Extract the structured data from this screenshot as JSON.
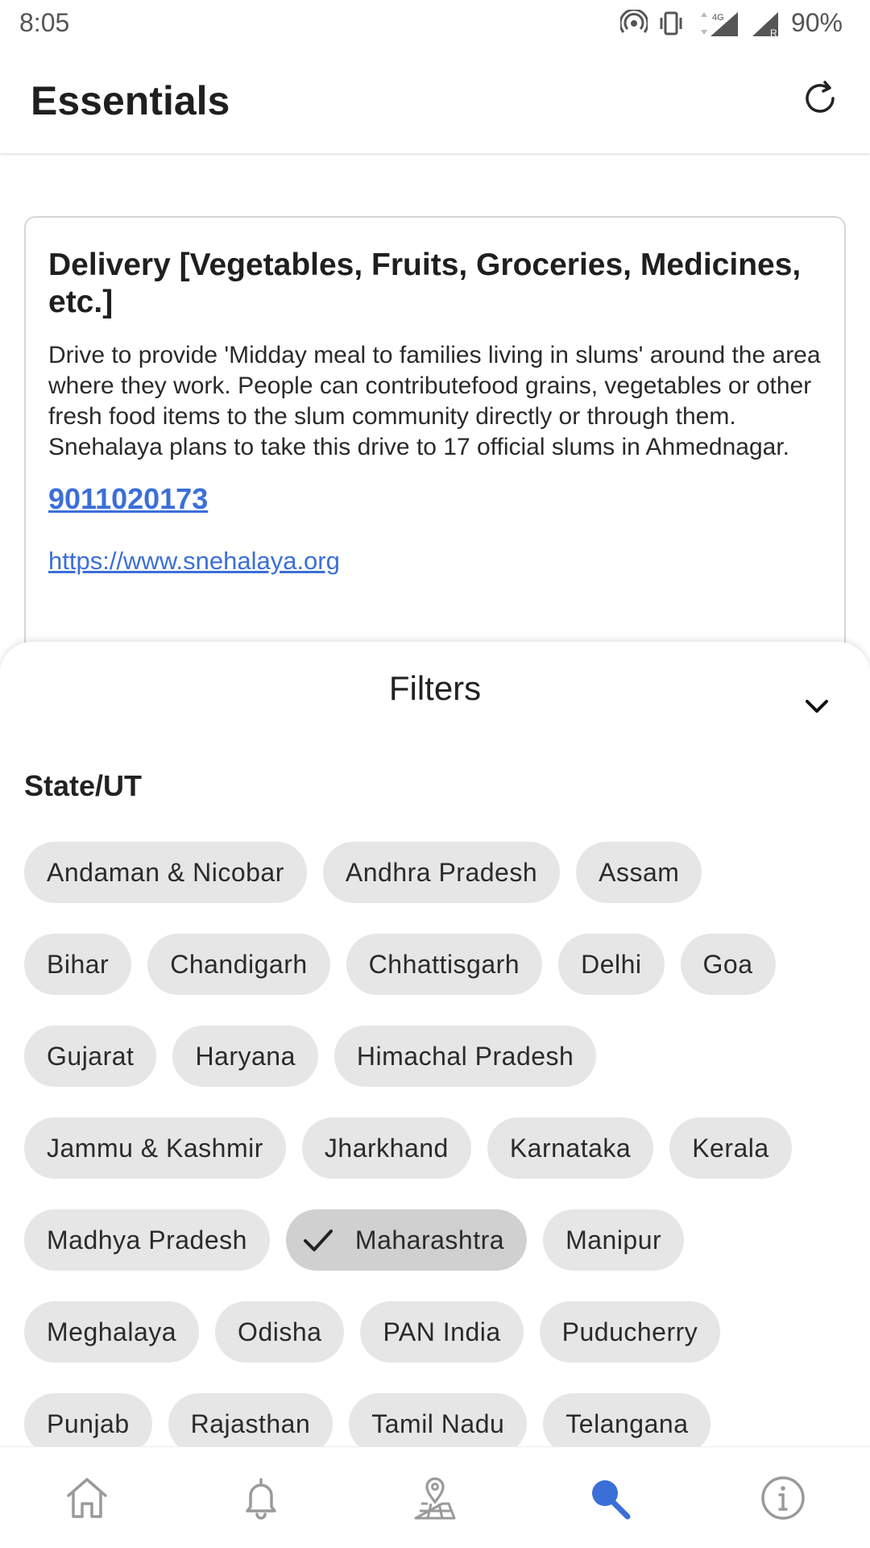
{
  "status_bar": {
    "time": "8:05",
    "network": "4G",
    "roaming": "R",
    "battery": "90%"
  },
  "app_bar": {
    "title": "Essentials",
    "refresh_icon": "refresh-icon"
  },
  "card": {
    "title": "Delivery [Vegetables, Fruits, Groceries, Medicines, etc.]",
    "description": "Drive to provide 'Midday meal to families living in slums' around the area where they work. People can contributefood grains, vegetables or other fresh food items to the slum community directly or through them. Snehalaya plans to take this drive to 17 official slums in Ahmednagar.",
    "phone": "9011020173",
    "url": "https://www.snehalaya.org"
  },
  "filters": {
    "title": "Filters",
    "section_label": "State/UT",
    "selected": "Maharashtra",
    "rows": [
      [
        "Andaman & Nicobar",
        "Andhra Pradesh",
        "Assam"
      ],
      [
        "Bihar",
        "Chandigarh",
        "Chhattisgarh",
        "Delhi",
        "Goa"
      ],
      [
        "Gujarat",
        "Haryana",
        "Himachal Pradesh"
      ],
      [
        "Jammu & Kashmir",
        "Jharkhand",
        "Karnataka",
        "Kerala"
      ],
      [
        "Madhya Pradesh",
        "Maharashtra",
        "Manipur"
      ],
      [
        "Meghalaya",
        "Odisha",
        "PAN India",
        "Puducherry"
      ],
      [
        "Punjab",
        "Rajasthan",
        "Tamil Nadu",
        "Telangana"
      ]
    ]
  },
  "bottom_nav": {
    "items": [
      "home-icon",
      "bell-icon",
      "map-icon",
      "search-icon",
      "info-icon"
    ],
    "active": "search-icon",
    "active_color": "#3b6fd8",
    "inactive_color": "#9a9a9a"
  }
}
